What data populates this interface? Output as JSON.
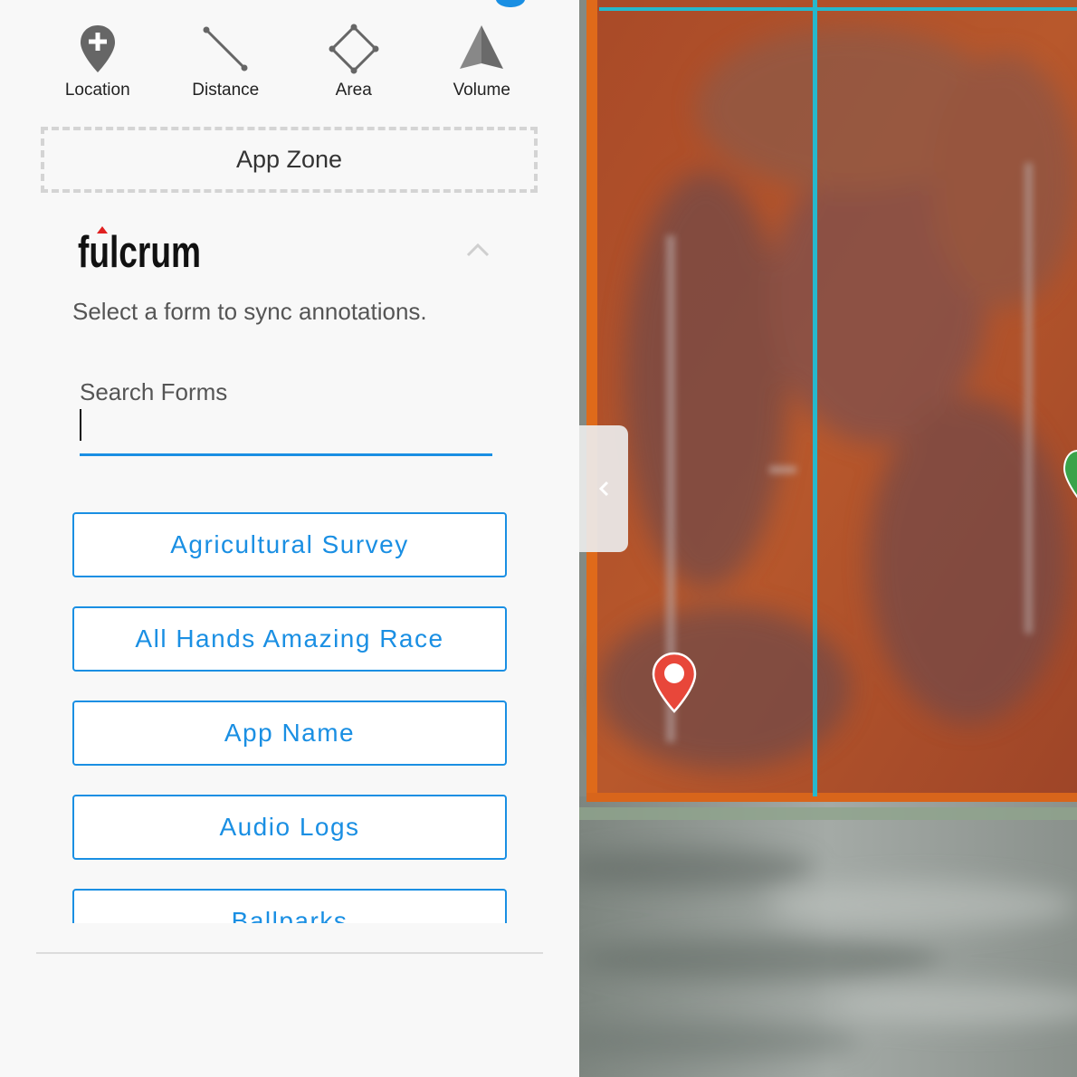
{
  "tools": {
    "location": {
      "label": "Location",
      "icon": "location-add-icon"
    },
    "distance": {
      "label": "Distance",
      "icon": "distance-icon"
    },
    "area": {
      "label": "Area",
      "icon": "area-icon"
    },
    "volume": {
      "label": "Volume",
      "icon": "volume-icon"
    }
  },
  "app_zone": {
    "label": "App Zone"
  },
  "fulcrum": {
    "logo_text": "fulcrum",
    "instruction": "Select a form to sync annotations.",
    "search_label": "Search Forms",
    "search_value": "",
    "forms": [
      "Agricultural Survey",
      "All Hands Amazing Race",
      "App Name",
      "Audio Logs",
      "Ballparks"
    ]
  },
  "map": {
    "collapse_icon": "chevron-left-icon",
    "marker_icon": "map-pin-icon"
  },
  "colors": {
    "accent": "#1a8fe3",
    "field_rust": "#b0502a",
    "field_boundary": "#df6a1a",
    "grid_line": "#26b8cc",
    "marker_red": "#e8473a"
  }
}
